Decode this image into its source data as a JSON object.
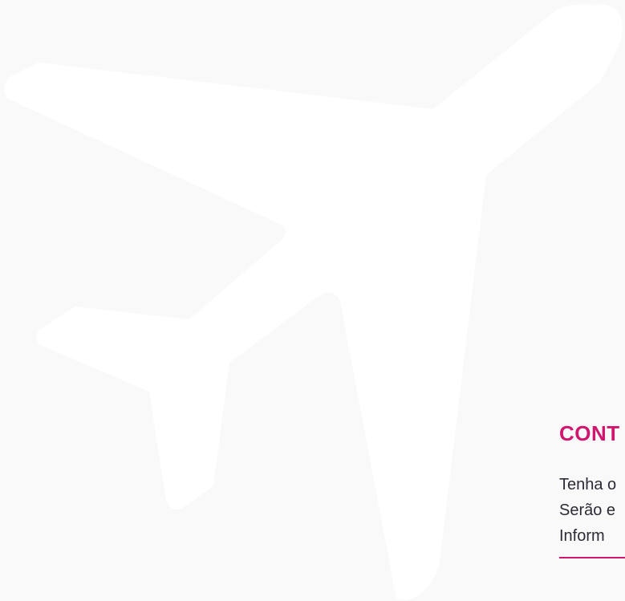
{
  "section": {
    "title": "CONT",
    "lines": [
      "Tenha o",
      "Serão e",
      "Inform"
    ]
  },
  "colors": {
    "accent": "#d1166e",
    "background": "#f9f9fa",
    "plane": "#ffffff"
  },
  "icons": {
    "background": "airplane-icon"
  }
}
